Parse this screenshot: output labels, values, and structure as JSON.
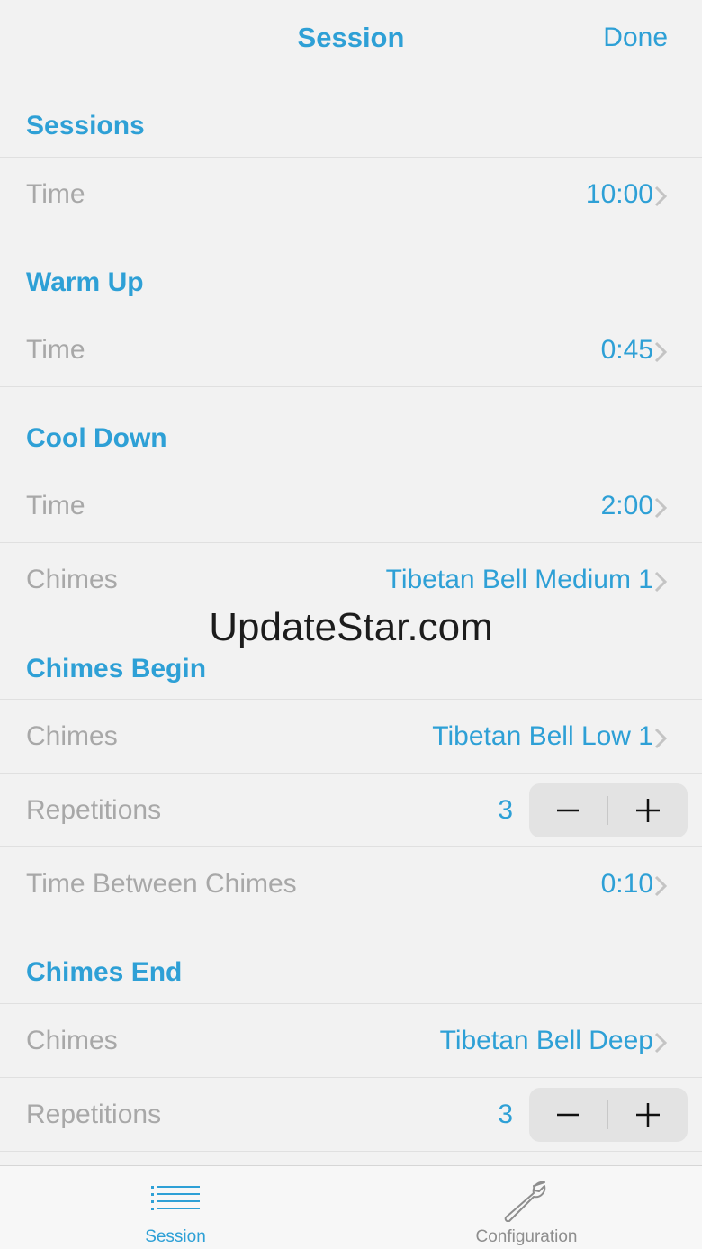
{
  "nav": {
    "title": "Session",
    "done_label": "Done"
  },
  "sections": {
    "sessions": {
      "header": "Sessions",
      "time_label": "Time",
      "time_value": "10:00"
    },
    "warm_up": {
      "header": "Warm Up",
      "time_label": "Time",
      "time_value": "0:45"
    },
    "cool_down": {
      "header": "Cool Down",
      "time_label": "Time",
      "time_value": "2:00",
      "chimes_label": "Chimes",
      "chimes_value": "Tibetan Bell Medium 1"
    },
    "chimes_begin": {
      "header": "Chimes Begin",
      "chimes_label": "Chimes",
      "chimes_value": "Tibetan Bell Low 1",
      "repetitions_label": "Repetitions",
      "repetitions_value": "3",
      "between_label": "Time Between Chimes",
      "between_value": "0:10"
    },
    "chimes_end": {
      "header": "Chimes End",
      "chimes_label": "Chimes",
      "chimes_value": "Tibetan Bell Deep",
      "repetitions_label": "Repetitions",
      "repetitions_value": "3"
    }
  },
  "stepper": {
    "minus": "−",
    "plus": "+"
  },
  "watermark": "UpdateStar.com",
  "tabbar": {
    "session_label": "Session",
    "session_icon": "list-icon",
    "config_label": "Configuration",
    "config_icon": "wrench-icon"
  },
  "colors": {
    "accent": "#2ea0d6",
    "label_gray": "#a8a8a8",
    "background": "#f2f2f2"
  }
}
